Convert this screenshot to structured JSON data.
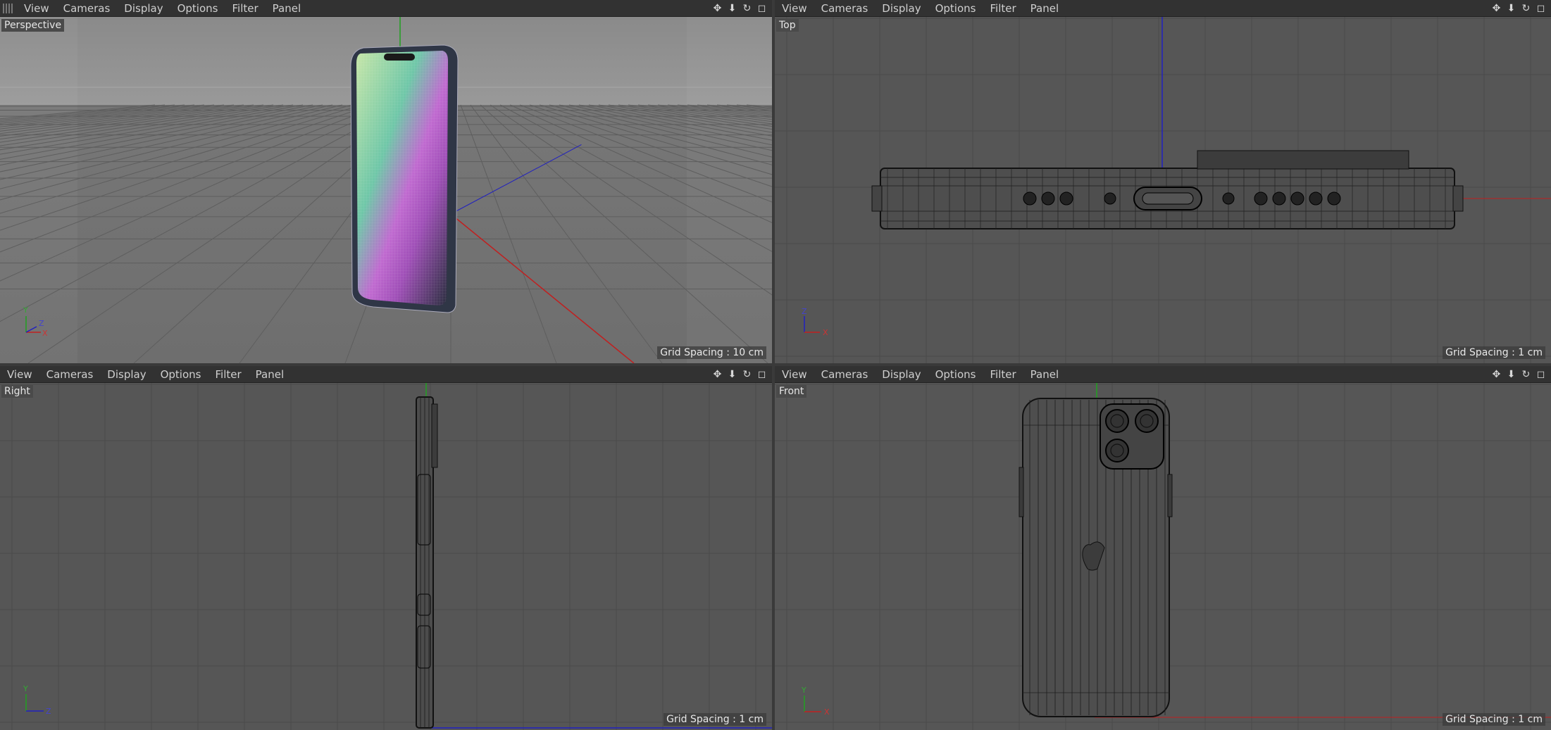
{
  "menu": [
    "View",
    "Cameras",
    "Display",
    "Options",
    "Filter",
    "Panel"
  ],
  "menu_tools": {
    "move": "move-icon",
    "download": "down-arrow-icon",
    "rotate": "rotate-icon",
    "maximize": "maximize-icon"
  },
  "viewports": {
    "perspective": {
      "label": "Perspective",
      "grid_spacing": "Grid Spacing : 10 cm",
      "axes": {
        "a": "Y",
        "b": "Z",
        "c": "X"
      }
    },
    "top": {
      "label": "Top",
      "grid_spacing": "Grid Spacing : 1 cm",
      "axes": {
        "a": "Z",
        "b": "X"
      }
    },
    "right": {
      "label": "Right",
      "grid_spacing": "Grid Spacing : 1 cm",
      "axes": {
        "a": "Y",
        "b": "Z"
      }
    },
    "front": {
      "label": "Front",
      "grid_spacing": "Grid Spacing : 1 cm",
      "axes": {
        "a": "Y",
        "b": "X"
      }
    }
  },
  "colors": {
    "background": "#565656",
    "grid": "#4c4c4c",
    "menubar": "#323232",
    "x_axis": "#c02020",
    "y_axis": "#20a020",
    "z_axis": "#2020c0"
  }
}
